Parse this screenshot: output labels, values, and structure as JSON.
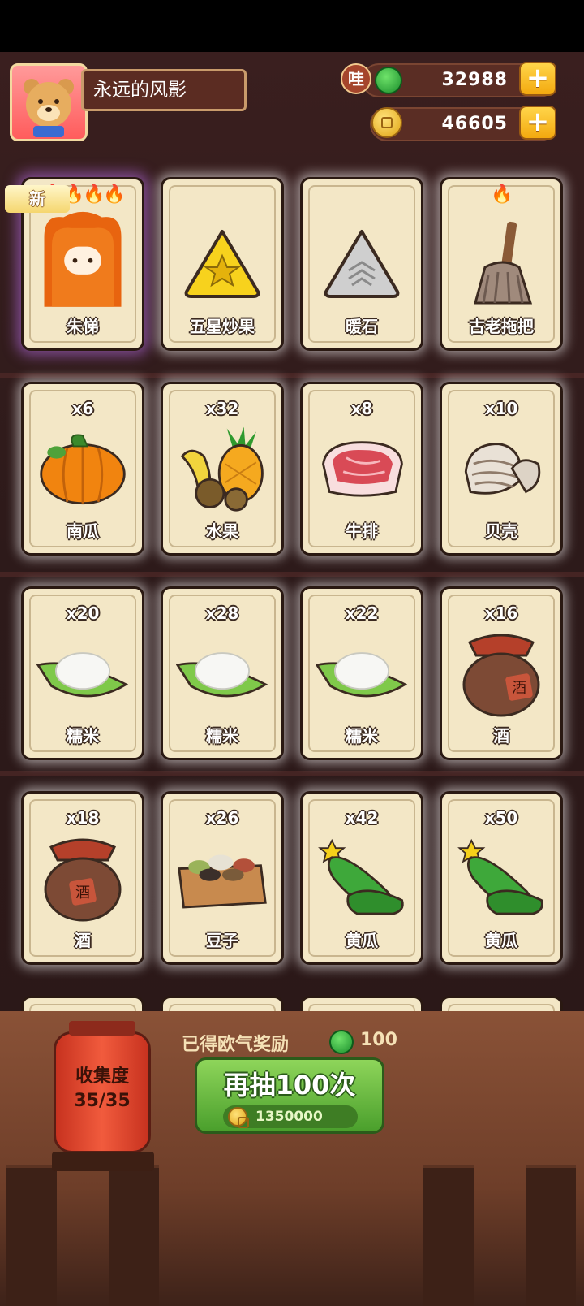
{
  "player": {
    "name": "永远的风影"
  },
  "currencies": {
    "jade_badge": "哇",
    "jade": "32988",
    "gold": "46605"
  },
  "new_tag": "新",
  "cards": [
    {
      "name": "朱悌",
      "count": "",
      "flames": "🔥🔥🔥🔥",
      "icon": "orange-creature-icon",
      "is_new": true
    },
    {
      "name": "五星炒果",
      "count": "",
      "flames": "",
      "icon": "star-fruit-icon"
    },
    {
      "name": "暖石",
      "count": "",
      "flames": "",
      "icon": "warm-stone-icon"
    },
    {
      "name": "古老拖把",
      "count": "",
      "flames": "🔥",
      "icon": "mop-icon"
    },
    {
      "name": "南瓜",
      "count": "x6",
      "icon": "pumpkin-icon"
    },
    {
      "name": "水果",
      "count": "x32",
      "icon": "fruit-icon"
    },
    {
      "name": "牛排",
      "count": "x8",
      "icon": "steak-icon"
    },
    {
      "name": "贝壳",
      "count": "x10",
      "icon": "shell-icon"
    },
    {
      "name": "糯米",
      "count": "x20",
      "icon": "sticky-rice-icon"
    },
    {
      "name": "糯米",
      "count": "x28",
      "icon": "sticky-rice-icon"
    },
    {
      "name": "糯米",
      "count": "x22",
      "icon": "sticky-rice-icon"
    },
    {
      "name": "酒",
      "count": "x16",
      "icon": "wine-jar-icon"
    },
    {
      "name": "酒",
      "count": "x18",
      "icon": "wine-jar-icon"
    },
    {
      "name": "豆子",
      "count": "x26",
      "icon": "beans-box-icon"
    },
    {
      "name": "黄瓜",
      "count": "x42",
      "icon": "cucumber-icon"
    },
    {
      "name": "黄瓜",
      "count": "x50",
      "icon": "cucumber-icon"
    }
  ],
  "collection": {
    "label": "收集度",
    "progress": "35/35"
  },
  "reward": {
    "label": "已得欧气奖励",
    "value": "100"
  },
  "draw_button": {
    "label": "再抽100次",
    "cost": "1350000"
  },
  "colors": {
    "button_green": "#5fb03a",
    "gold": "#f3b51d",
    "card_bg": "#f3e7c6"
  }
}
